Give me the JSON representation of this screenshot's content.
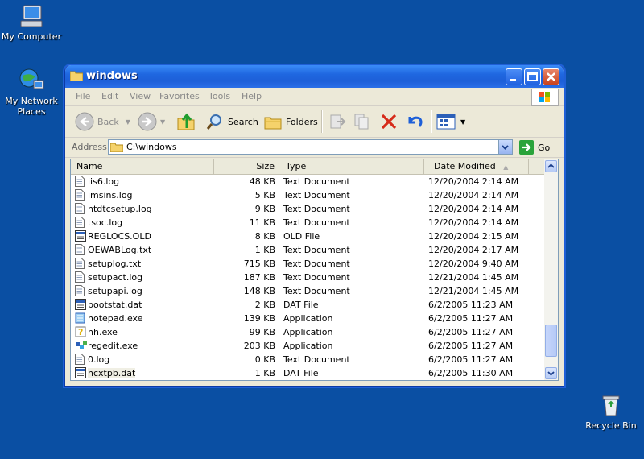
{
  "desktop": {
    "icons": [
      {
        "label": "My Computer"
      },
      {
        "label": "My Network Places"
      },
      {
        "label": "Recycle Bin"
      }
    ]
  },
  "window": {
    "title": "windows",
    "menu": [
      "File",
      "Edit",
      "View",
      "Favorites",
      "Tools",
      "Help"
    ],
    "toolbar": {
      "back": "Back",
      "search": "Search",
      "folders": "Folders"
    },
    "address": {
      "label": "Address",
      "value": "C:\\windows",
      "go": "Go"
    },
    "columns": [
      "Name",
      "Size",
      "Type",
      "Date Modified"
    ],
    "files": [
      {
        "name": "iis6.log",
        "size": "48 KB",
        "type": "Text Document",
        "date": "12/20/2004 2:14 AM",
        "icon": "text-file-icon"
      },
      {
        "name": "imsins.log",
        "size": "5 KB",
        "type": "Text Document",
        "date": "12/20/2004 2:14 AM",
        "icon": "text-file-icon"
      },
      {
        "name": "ntdtcsetup.log",
        "size": "9 KB",
        "type": "Text Document",
        "date": "12/20/2004 2:14 AM",
        "icon": "text-file-icon"
      },
      {
        "name": "tsoc.log",
        "size": "11 KB",
        "type": "Text Document",
        "date": "12/20/2004 2:14 AM",
        "icon": "text-file-icon"
      },
      {
        "name": "REGLOCS.OLD",
        "size": "8 KB",
        "type": "OLD File",
        "date": "12/20/2004 2:15 AM",
        "icon": "generic-file-icon"
      },
      {
        "name": "OEWABLog.txt",
        "size": "1 KB",
        "type": "Text Document",
        "date": "12/20/2004 2:17 AM",
        "icon": "text-file-icon"
      },
      {
        "name": "setuplog.txt",
        "size": "715 KB",
        "type": "Text Document",
        "date": "12/20/2004 9:40 AM",
        "icon": "text-file-icon"
      },
      {
        "name": "setupact.log",
        "size": "187 KB",
        "type": "Text Document",
        "date": "12/21/2004 1:45 AM",
        "icon": "text-file-icon"
      },
      {
        "name": "setupapi.log",
        "size": "148 KB",
        "type": "Text Document",
        "date": "12/21/2004 1:45 AM",
        "icon": "text-file-icon"
      },
      {
        "name": "bootstat.dat",
        "size": "2 KB",
        "type": "DAT File",
        "date": "6/2/2005 11:23 AM",
        "icon": "generic-file-icon"
      },
      {
        "name": "notepad.exe",
        "size": "139 KB",
        "type": "Application",
        "date": "6/2/2005 11:27 AM",
        "icon": "notepad-icon"
      },
      {
        "name": "hh.exe",
        "size": "99 KB",
        "type": "Application",
        "date": "6/2/2005 11:27 AM",
        "icon": "help-icon"
      },
      {
        "name": "regedit.exe",
        "size": "203 KB",
        "type": "Application",
        "date": "6/2/2005 11:27 AM",
        "icon": "regedit-icon"
      },
      {
        "name": "0.log",
        "size": "0 KB",
        "type": "Text Document",
        "date": "6/2/2005 11:27 AM",
        "icon": "text-file-icon"
      },
      {
        "name": "hcxtpb.dat",
        "size": "1 KB",
        "type": "DAT File",
        "date": "6/2/2005 11:30 AM",
        "icon": "generic-file-icon"
      }
    ]
  },
  "colors": {
    "desktop": "#0a4fa3",
    "titlebar": "#1f67e0",
    "close": "#c9421d"
  }
}
